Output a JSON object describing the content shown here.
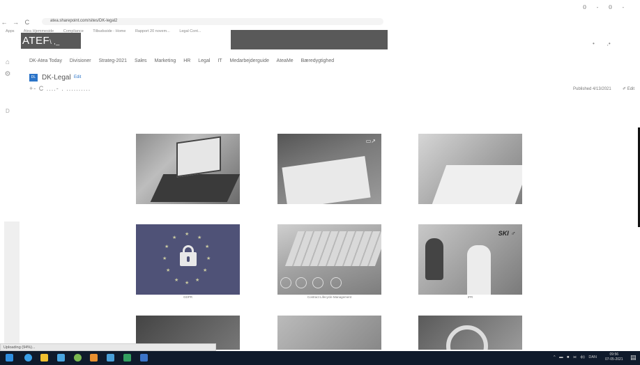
{
  "browser": {
    "back": "←",
    "forward": "→",
    "reload": "C",
    "url": "atea.sharepoint.com/sites/DK-legal2",
    "bookmarks": [
      "Apps",
      "Atea Hjemmeside",
      "Compliance",
      "Tilbudsside - Home",
      "Rapport 20 novem...",
      "Legal Cont..."
    ],
    "window_controls": [
      "0",
      "-",
      "0",
      "-"
    ],
    "ext_icons": [
      "•",
      ",•"
    ]
  },
  "overlay": {
    "atef_text": "ATEF",
    "atef_suffix": "\\ ,_"
  },
  "site": {
    "rail_icons": [
      "⌂",
      "⚙"
    ],
    "topnav": [
      "DK-Atea Today",
      "Divisioner",
      "Strateg-2021",
      "Sales",
      "Marketing",
      "HR",
      "Legal",
      "IT",
      "Medarbejderguide",
      "AteaMe",
      "Bæredygtighed"
    ],
    "logo_text": "DL",
    "title": "DK-Legal",
    "edit_label": "Edit",
    "breadcrumb": "+-      C ....- .      ..........",
    "published": "Published 4/13/2021",
    "page_edit": "✐ Edit",
    "stray_char": "D"
  },
  "tiles": {
    "r1": [
      "",
      "",
      ""
    ],
    "gdpr_caption": "GDPR",
    "contract_caption": "Contract Lifecycle Management",
    "ski_caption": "IPR",
    "ski_logo": "SKI ♂"
  },
  "status": {
    "text": "Uploading (94%)..."
  },
  "taskbar": {
    "tray": [
      "^",
      "▬",
      "■",
      "⫘",
      "ф)",
      "DAN"
    ],
    "time": "09:56",
    "date": "07-05-2021",
    "notif": "▤"
  },
  "colors": {
    "taskbar": "#0f1a2b",
    "brand_blue": "#2b74c8",
    "gdpr_tile": "#4f5277"
  }
}
